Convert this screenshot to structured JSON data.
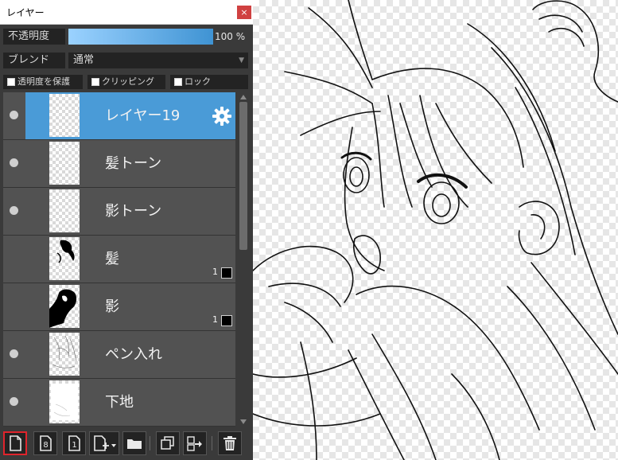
{
  "panel": {
    "title": "レイヤー",
    "close_label": "×",
    "opacity_label": "不透明度",
    "opacity_value": "100 %",
    "opacity_fraction": 1.0,
    "blend_label": "ブレンド",
    "blend_value": "通常",
    "checkboxes": [
      {
        "label": "透明度を保護",
        "checked": false
      },
      {
        "label": "クリッピング",
        "checked": false
      },
      {
        "label": "ロック",
        "checked": false
      }
    ]
  },
  "layers": [
    {
      "name": "レイヤー19",
      "visible": true,
      "selected": true,
      "has_settings": true,
      "opacity_badge": ""
    },
    {
      "name": "髪トーン",
      "visible": true,
      "selected": false,
      "opacity_badge": ""
    },
    {
      "name": "影トーン",
      "visible": true,
      "selected": false,
      "opacity_badge": ""
    },
    {
      "name": "髪",
      "visible": false,
      "selected": false,
      "opacity_badge": "1"
    },
    {
      "name": "影",
      "visible": false,
      "selected": false,
      "opacity_badge": "1"
    },
    {
      "name": "ペン入れ",
      "visible": true,
      "selected": false,
      "opacity_badge": ""
    },
    {
      "name": "下地",
      "visible": true,
      "selected": false,
      "opacity_badge": ""
    }
  ],
  "toolbar": {
    "buttons": [
      {
        "name": "new-layer-button",
        "icon": "page-icon",
        "highlighted": true
      },
      {
        "name": "new-8bit-layer-button",
        "icon": "page-8-icon",
        "text": "8"
      },
      {
        "name": "new-1bit-layer-button",
        "icon": "page-1-icon",
        "text": "1"
      },
      {
        "name": "add-layer-menu-button",
        "icon": "page-plus-icon"
      },
      {
        "name": "new-folder-button",
        "icon": "folder-icon"
      },
      {
        "name": "duplicate-layer-button",
        "icon": "duplicate-icon"
      },
      {
        "name": "merge-layer-button",
        "icon": "merge-icon"
      },
      {
        "name": "delete-layer-button",
        "icon": "trash-icon"
      }
    ]
  },
  "colors": {
    "selection": "#4a9bd7",
    "panel_bg": "#3a3a3a",
    "row_bg": "#525252",
    "highlight_border": "#e0242c"
  }
}
